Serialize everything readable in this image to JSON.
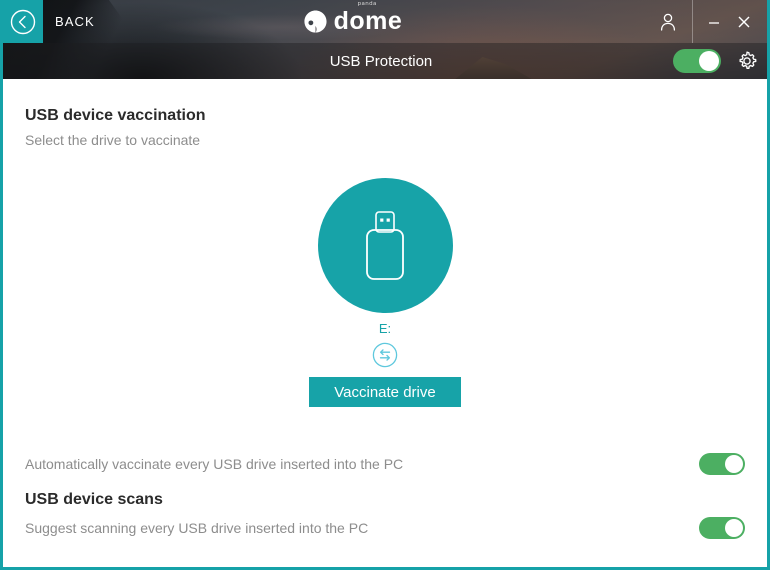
{
  "window": {
    "back_label": "BACK",
    "brand_small": "panda",
    "brand_name": "dome",
    "minimize_label": "–",
    "close_label": "✕"
  },
  "module": {
    "title": "USB Protection",
    "protection_enabled": true,
    "settings_icon": "gear-icon"
  },
  "main": {
    "heading": "USB device vaccination",
    "subheading": "Select the drive to vaccinate",
    "drive_letter": "E:",
    "drive_icon": "usb-drive-icon",
    "change_drive_icon": "swap-arrows-icon",
    "vaccinate_button": "Vaccinate drive"
  },
  "options": [
    {
      "label": "Automatically vaccinate every USB drive inserted into the PC",
      "enabled": true
    },
    {
      "heading": "USB device scans",
      "label": "Suggest scanning every USB drive inserted into the PC",
      "enabled": true
    }
  ],
  "colors": {
    "teal": "#17a3a8",
    "toggle_green": "#4caf62",
    "heading": "#2b2b2b",
    "muted": "#8d8d8d"
  }
}
